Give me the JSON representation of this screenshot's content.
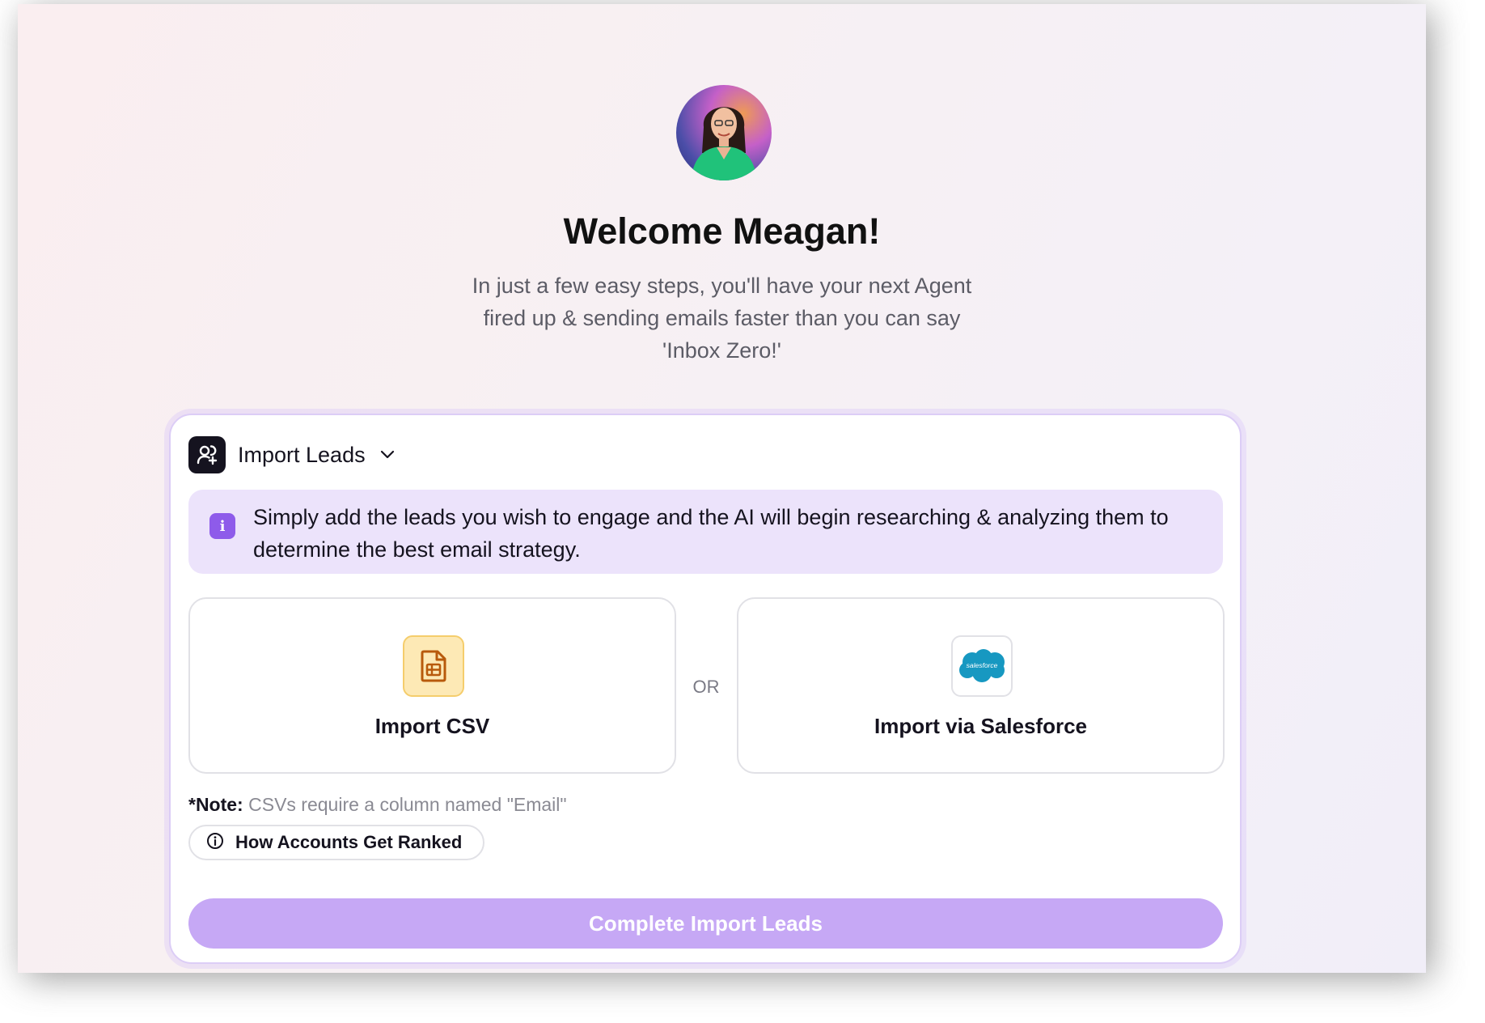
{
  "welcome": {
    "title": "Welcome Meagan!",
    "subtitle": "In just a few easy steps, you'll have your next Agent fired up & sending emails faster than you can say 'Inbox Zero!'"
  },
  "panel": {
    "title": "Import Leads",
    "info_text": "Simply add the leads you wish to engage and the AI will begin researching & analyzing them to determine the best email strategy.",
    "option_csv_label": "Import CSV",
    "or_label": "OR",
    "option_salesforce_label": "Import via Salesforce",
    "salesforce_logo_text": "salesforce",
    "note_prefix": "*Note:",
    "note_text": "CSVs require a column named \"Email\"",
    "ranked_button_label": "How Accounts Get Ranked",
    "complete_button_label": "Complete Import Leads"
  },
  "icons": {
    "header": "user-plus-icon",
    "info": "info-icon",
    "csv": "file-spreadsheet-icon",
    "salesforce": "salesforce-logo",
    "ranked": "info-circle-icon",
    "dropdown": "chevron-down-icon"
  },
  "colors": {
    "accent": "#8e5bea",
    "info_bg": "#ece3fb",
    "button_disabled": "#c6a8f5",
    "csv_icon_bg": "#fde9b5",
    "salesforce_blue": "#1798c1"
  }
}
